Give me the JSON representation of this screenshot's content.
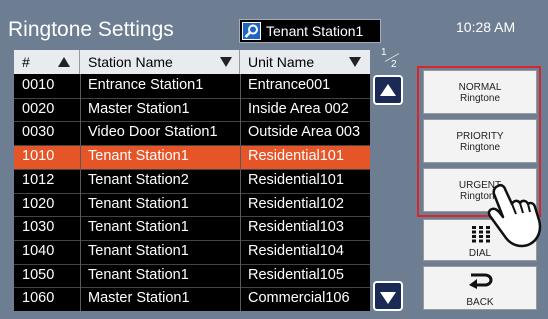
{
  "header": {
    "title": "Ringtone Settings",
    "search_value": "Tenant Station1",
    "time": "10:28 AM"
  },
  "table": {
    "columns": [
      "#",
      "Station Name",
      "Unit Name"
    ],
    "rows": [
      {
        "num": "0010",
        "station": "Entrance Station1",
        "unit": "Entrance001"
      },
      {
        "num": "0020",
        "station": "Master Station1",
        "unit": "Inside Area 002"
      },
      {
        "num": "0030",
        "station": "Video Door Station1",
        "unit": "Outside Area 003"
      },
      {
        "num": "1010",
        "station": "Tenant Station1",
        "unit": "Residential101"
      },
      {
        "num": "1012",
        "station": "Tenant Station2",
        "unit": "Residential101"
      },
      {
        "num": "1020",
        "station": "Tenant Station1",
        "unit": "Residential102"
      },
      {
        "num": "1030",
        "station": "Tenant Station1",
        "unit": "Residential103"
      },
      {
        "num": "1040",
        "station": "Tenant Station1",
        "unit": "Residential104"
      },
      {
        "num": "1050",
        "station": "Tenant Station1",
        "unit": "Residential105"
      },
      {
        "num": "1060",
        "station": "Master Station1",
        "unit": "Commercial106"
      }
    ],
    "selected_index": 3
  },
  "pagination": {
    "current": "1",
    "total": "2"
  },
  "buttons": {
    "normal": {
      "line1": "NORMAL",
      "line2": "Ringtone"
    },
    "priority": {
      "line1": "PRIORITY",
      "line2": "Ringtone"
    },
    "urgent": {
      "line1": "URGENT",
      "line2": "Ringtone"
    },
    "dial": "DIAL",
    "back": "BACK"
  },
  "icons": {
    "search": "search-icon",
    "dial": "keypad-icon",
    "back": "back-arrow-icon",
    "pointer": "hand-pointer-icon"
  },
  "colors": {
    "background": "#6d7d92",
    "selected_row": "#e65527",
    "search_icon": "#1e66c4",
    "highlight_frame": "#d7262c"
  }
}
